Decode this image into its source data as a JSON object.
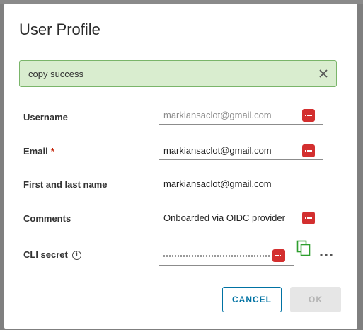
{
  "dialog": {
    "title": "User Profile",
    "alert": {
      "message": "copy success",
      "type": "success"
    },
    "fields": {
      "username": {
        "label": "Username",
        "value": "markiansaclot@gmail.com",
        "readonly": true
      },
      "email": {
        "label": "Email",
        "required_marker": "*",
        "value": "markiansaclot@gmail.com"
      },
      "full_name": {
        "label": "First and last name",
        "value": "markiansaclot@gmail.com"
      },
      "comments": {
        "label": "Comments",
        "value": "Onboarded via OIDC provider"
      },
      "cli_secret": {
        "label": "CLI secret",
        "value": "•••••••••••••••••••••••••••••••••••"
      }
    },
    "buttons": {
      "cancel": "CANCEL",
      "ok": "OK"
    }
  },
  "icons": {
    "alert_close": "close-icon",
    "password_manager": "keepass-icon",
    "info": "info-icon",
    "copy": "copy-icon",
    "more": "more-icon"
  },
  "colors": {
    "alert_bg": "#d9edcf",
    "alert_border": "#7ab56a",
    "primary": "#0072a3",
    "keepass": "#d32f2f",
    "copy_icon": "#2e9e2e",
    "required": "#c21d00"
  }
}
